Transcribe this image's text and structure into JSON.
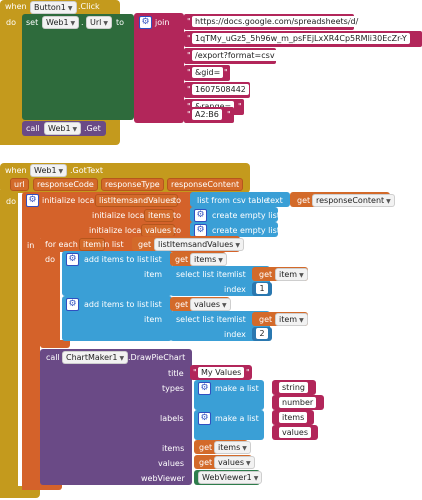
{
  "colors": {
    "event": "#c49a1d",
    "event_dark": "#a07a10",
    "web": "#2e6b3c",
    "text": "#b2265a",
    "local": "#d4622a",
    "list": "#3a9fd6",
    "list_dark": "#2a78b0",
    "chart": "#6a4a86",
    "var": "#d36a2a",
    "viewer": "#2e7d4c"
  },
  "button_click": {
    "when": "when",
    "component": "Button1",
    "event": ".Click",
    "do": "do",
    "set": "set",
    "web": "Web1",
    "prop": "Url",
    "to": "to",
    "join": "join",
    "strings": [
      "https://docs.google.com/spreadsheets/d/",
      "1qTMy_uGz5_5h96w_m_psFEjLxXR4Cp5RMli30EcZr-Y",
      "/export?format=csv",
      "&gid=",
      "1607508442",
      "&range=",
      "A2:B6"
    ],
    "call": "call",
    "call_web": "Web1",
    "call_method": ".Get"
  },
  "got_text": {
    "when": "when",
    "component": "Web1",
    "event": ".GotText",
    "params": [
      "url",
      "responseCode",
      "responseType",
      "responseContent"
    ],
    "do": "do",
    "init_local": "initialize local",
    "var1": "listItemsandValues",
    "to": "to",
    "csv_table": "list from csv table",
    "text": "text",
    "get": "get",
    "response_content": "responseContent",
    "var2": "items",
    "var3": "values",
    "empty_list": "create empty list",
    "in": "in",
    "for_each": "for each",
    "item": "item",
    "in_list": "in list",
    "list_var": "listItemsandValues",
    "add_items": "add items to list",
    "list": "list",
    "item_label": "item",
    "select_list_item": "select list item",
    "index": "index",
    "index1": "1",
    "index2": "2",
    "call": "call",
    "chart": "ChartMaker1",
    "draw": ".DrawPieChart",
    "title_label": "title",
    "title_value": "My Values",
    "types_label": "types",
    "make_list": "make a list",
    "type_vals": [
      "string",
      "number"
    ],
    "labels_label": "labels",
    "label_vals": [
      "items",
      "values"
    ],
    "items_label": "items",
    "values_label": "values",
    "webviewer_label": "webViewer",
    "webviewer": "WebViewer1"
  }
}
